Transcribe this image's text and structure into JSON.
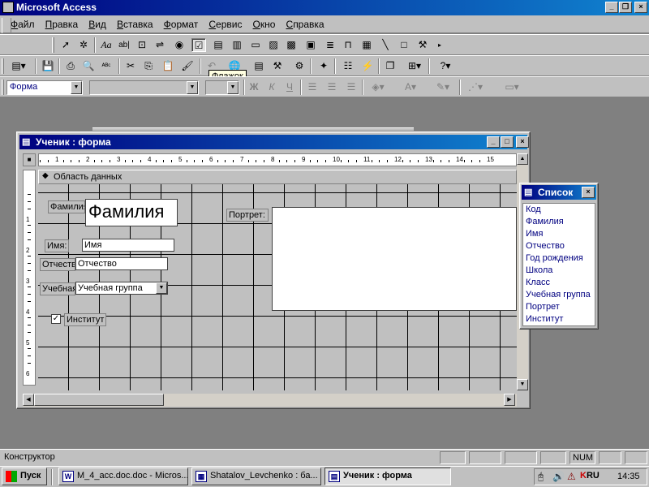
{
  "app": {
    "title": "Microsoft Access"
  },
  "menu": [
    {
      "label": "Файл",
      "key": "Ф",
      "rest": "айл"
    },
    {
      "label": "Правка",
      "key": "П",
      "rest": "равка"
    },
    {
      "label": "Вид",
      "key": "В",
      "rest": "ид"
    },
    {
      "label": "Вставка",
      "key": "В",
      "rest": "ставка"
    },
    {
      "label": "Формат",
      "key": "Ф",
      "rest": "ормат"
    },
    {
      "label": "Сервис",
      "key": "С",
      "rest": "ервис"
    },
    {
      "label": "Окно",
      "key": "О",
      "rest": "кно"
    },
    {
      "label": "Справка",
      "key": "С",
      "rest": "правка"
    }
  ],
  "toolbox": {
    "icons": [
      "pointer-icon",
      "wizard-icon",
      "label-icon",
      "textbox-icon",
      "option-group-icon",
      "toggle-icon",
      "option-button-icon",
      "checkbox-icon",
      "combo-box-icon",
      "list-box-icon",
      "command-button-icon",
      "image-icon",
      "unbound-frame-icon",
      "bound-frame-icon",
      "page-break-icon",
      "tab-control-icon",
      "subform-icon",
      "line-icon",
      "rectangle-icon",
      "more-controls-icon"
    ],
    "glyphs": {
      "label": "Aa",
      "textbox": "ab|"
    }
  },
  "tooltip": {
    "text": "Флажок"
  },
  "format_bar": {
    "object": "Форма",
    "font": "",
    "size": "",
    "bold": "Ж",
    "italic": "К",
    "underline": "Ч"
  },
  "form_window": {
    "title": "Ученик : форма",
    "section": "Область данных",
    "ruler_ticks": [
      "1",
      "2",
      "3",
      "4",
      "5",
      "6",
      "7",
      "8",
      "9",
      "10",
      "11",
      "12",
      "13",
      "14",
      "15"
    ],
    "vruler_ticks": [
      "1",
      "2",
      "3",
      "4",
      "5",
      "6"
    ],
    "controls": {
      "familia_label": "Фамилия",
      "familia_box": "Фамилия",
      "imya_label": "Имя:",
      "imya_box": "Имя",
      "otchestvo_label": "Отчество",
      "otchestvo_box": "Отчество",
      "group_label": "Учебная",
      "group_combo": "Учебная группа",
      "portret_label": "Портрет:",
      "institut_label": "Институт"
    }
  },
  "field_list": {
    "title": "Список",
    "items": [
      "Код",
      "Фамилия",
      "Имя",
      "Отчество",
      "Год рождения",
      "Школа",
      "Класс",
      "Учебная группа",
      "Портрет",
      "Институт"
    ]
  },
  "status": {
    "mode": "Конструктор",
    "num": "NUM"
  },
  "taskbar": {
    "start": "Пуск",
    "tasks": [
      {
        "label": "M_4_acc.doc.doc - Micros...",
        "icon": "W"
      },
      {
        "label": "Shatalov_Levchenko : ба...",
        "icon": "▦"
      },
      {
        "label": "Ученик : форма",
        "icon": "▤"
      }
    ],
    "lang": "RU",
    "clock": "14:35"
  }
}
